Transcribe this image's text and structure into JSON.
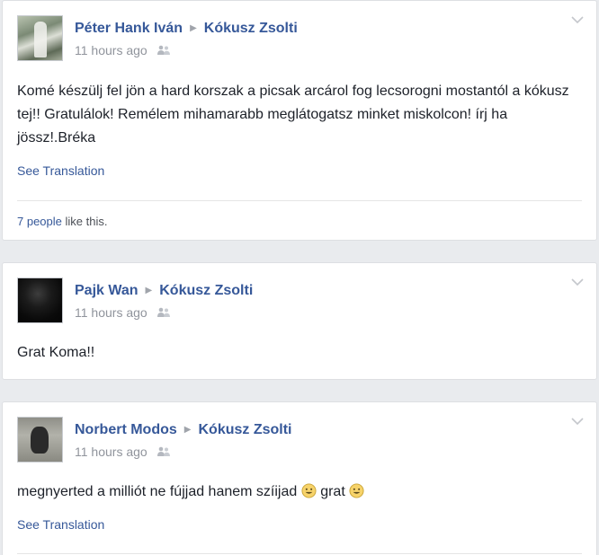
{
  "posts": [
    {
      "author": "Péter Hank Iván",
      "target": "Kókusz Zsolti",
      "time": "11 hours ago",
      "text": "Komé készülj fel jön a hard korszak a picsak arcárol fog lecsorogni mostantól a kókusz tej!! Gratulálok! Remélem mihamarabb meglátogatsz minket miskolcon! írj ha jössz!.Bréka",
      "see_translation": "See Translation",
      "likes_count": "7 people",
      "likes_suffix": "like this."
    },
    {
      "author": "Pajk Wan",
      "target": "Kókusz Zsolti",
      "time": "11 hours ago",
      "text": "Grat Koma!!"
    },
    {
      "author": "Norbert Modos",
      "target": "Kókusz Zsolti",
      "time": "11 hours ago",
      "text_part1": "megnyerted a milliót ne fújjad hanem szíijad",
      "text_part2": "grat",
      "see_translation": "See Translation"
    }
  ],
  "icons": {
    "privacy": "friends-icon",
    "options": "chevron-down-icon",
    "separator": "triangle-right-icon",
    "emoji": "smile-emoji-icon"
  },
  "colors": {
    "link": "#365899",
    "meta": "#90949c",
    "text": "#1d2129",
    "background": "#e9ebee"
  }
}
